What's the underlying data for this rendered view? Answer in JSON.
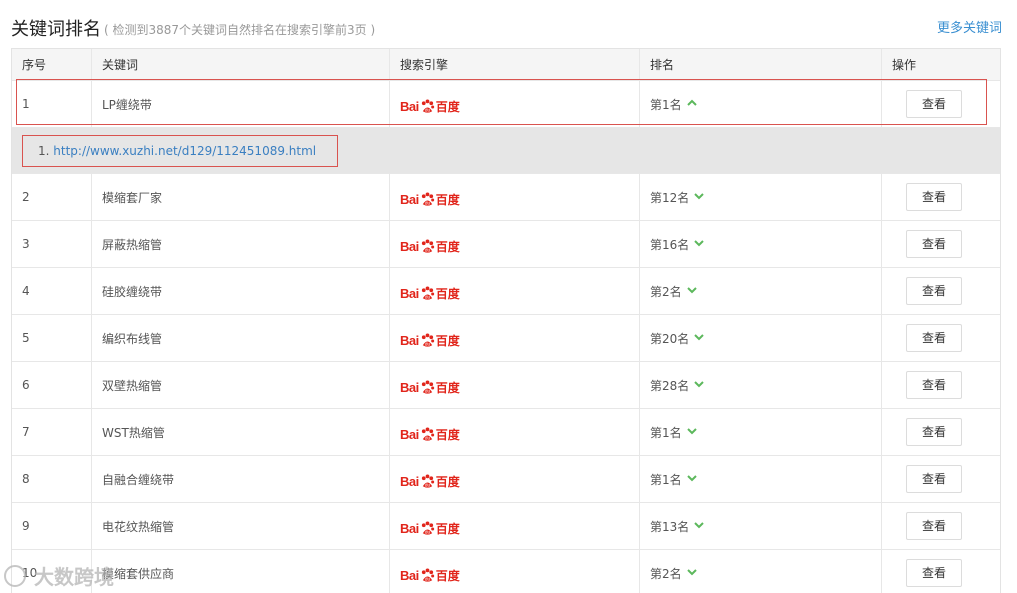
{
  "header": {
    "title": "关键词排名",
    "subtitle": "( 检测到3887个关键词自然排名在搜索引擎前3页 )",
    "more_link": "更多关键词"
  },
  "table": {
    "columns": [
      "序号",
      "关键词",
      "搜索引擎",
      "排名",
      "操作"
    ],
    "engine_label": {
      "bai": "Bai",
      "du": "百度"
    },
    "view_label": "查看",
    "expanded_url": {
      "index": "1.",
      "url": "http://www.xuzhi.net/d129/112451089.html"
    },
    "rows": [
      {
        "index": "1",
        "keyword": "LP缠绕带",
        "rank": "第1名",
        "trend": "up"
      },
      {
        "index": "2",
        "keyword": "模缩套厂家",
        "rank": "第12名",
        "trend": "down"
      },
      {
        "index": "3",
        "keyword": "屏蔽热缩管",
        "rank": "第16名",
        "trend": "down"
      },
      {
        "index": "4",
        "keyword": "硅胶缠绕带",
        "rank": "第2名",
        "trend": "down"
      },
      {
        "index": "5",
        "keyword": "编织布线管",
        "rank": "第20名",
        "trend": "down"
      },
      {
        "index": "6",
        "keyword": "双壁热缩管",
        "rank": "第28名",
        "trend": "down"
      },
      {
        "index": "7",
        "keyword": "WST热缩管",
        "rank": "第1名",
        "trend": "down"
      },
      {
        "index": "8",
        "keyword": "自融合缠绕带",
        "rank": "第1名",
        "trend": "down"
      },
      {
        "index": "9",
        "keyword": "电花纹热缩管",
        "rank": "第13名",
        "trend": "down"
      },
      {
        "index": "10",
        "keyword": "模缩套供应商",
        "rank": "第2名",
        "trend": "down"
      }
    ]
  },
  "watermark": {
    "text": "大数跨境"
  },
  "colors": {
    "accent": "#3a8fd1",
    "baidu_red": "#e1251b",
    "trend_green": "#5cb85c",
    "highlight": "#d9534f"
  }
}
